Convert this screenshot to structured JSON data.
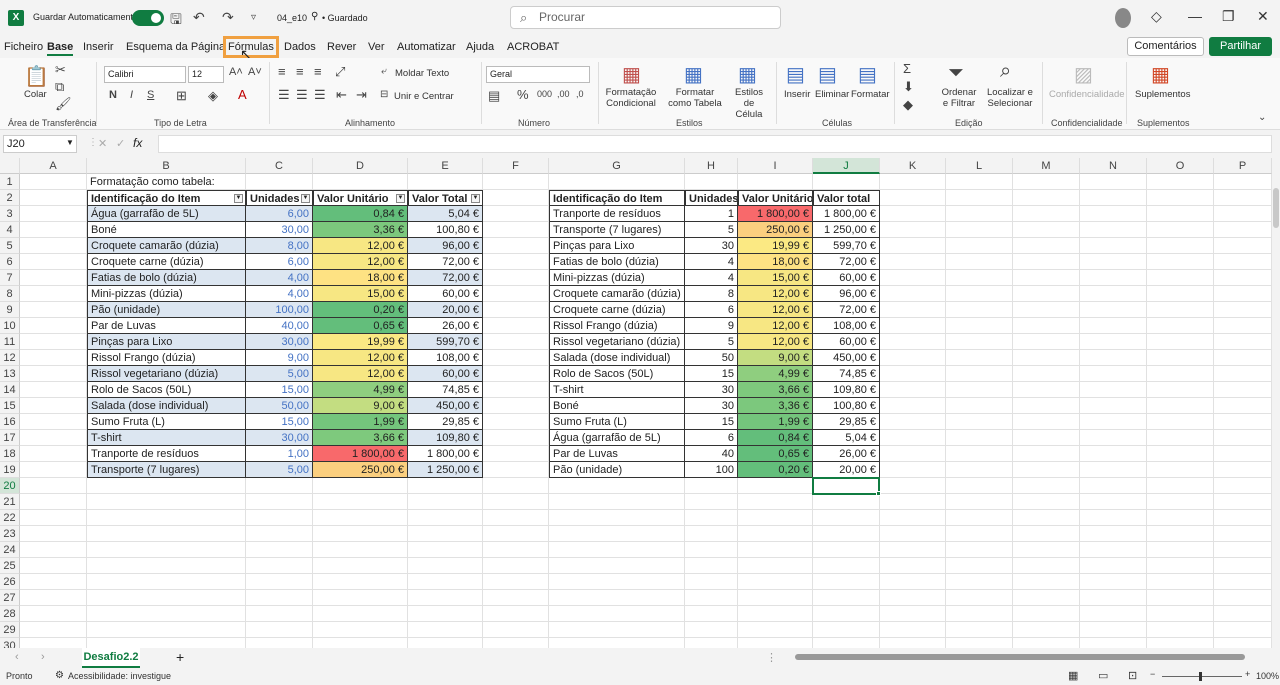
{
  "titlebar": {
    "autosave_label": "Guardar Automaticamente",
    "filename": "04_e10",
    "saved_status": "• Guardado",
    "search_placeholder": "Procurar"
  },
  "menu": {
    "tabs": [
      "Ficheiro",
      "Base",
      "Inserir",
      "Esquema da Página",
      "Fórmulas",
      "Dados",
      "Rever",
      "Ver",
      "Automatizar",
      "Ajuda",
      "ACROBAT"
    ],
    "comments_label": "Comentários",
    "share_label": "Partilhar"
  },
  "ribbon": {
    "paste_label": "Colar",
    "clipboard_group": "Área de Transferência",
    "font_name": "Calibri",
    "font_size": "12",
    "font_group": "Tipo de Letra",
    "wrap_text": "Moldar Texto",
    "merge_center": "Unir e Centrar",
    "alignment_group": "Alinhamento",
    "number_format": "Geral",
    "number_group": "Número",
    "cond_format": "Formatação Condicional",
    "format_table": "Formatar como Tabela",
    "cell_styles": "Estilos de Célula",
    "styles_group": "Estilos",
    "insert": "Inserir",
    "delete": "Eliminar",
    "format": "Formatar",
    "cells_group": "Células",
    "sort_filter": "Ordenar e Filtrar",
    "find_select": "Localizar e Selecionar",
    "editing_group": "Edição",
    "confidentiality": "Confidencialidade",
    "confidentiality_group": "Confidencialidade",
    "addins": "Suplementos",
    "addins_group": "Suplementos"
  },
  "formula_bar": {
    "name_box": "J20",
    "fx": "fx"
  },
  "columns": [
    "A",
    "B",
    "C",
    "D",
    "E",
    "F",
    "G",
    "H",
    "I",
    "J",
    "K",
    "L",
    "M",
    "N",
    "O",
    "P"
  ],
  "rows": [
    "1",
    "2",
    "3",
    "4",
    "5",
    "6",
    "7",
    "8",
    "9",
    "10",
    "11",
    "12",
    "13",
    "14",
    "15",
    "16",
    "17",
    "18",
    "19",
    "20",
    "21",
    "22",
    "23",
    "24",
    "25",
    "26",
    "27",
    "28",
    "29",
    "30"
  ],
  "table1": {
    "caption": "Formatação como tabela:",
    "headers": [
      "Identificação do Item",
      "Unidades",
      "Valor Unitário",
      "Valor Total"
    ],
    "rows": [
      [
        "Água (garrafão de 5L)",
        "6,00",
        "0,84 €",
        "5,04 €"
      ],
      [
        "Boné",
        "30,00",
        "3,36 €",
        "100,80 €"
      ],
      [
        "Croquete camarão (dúzia)",
        "8,00",
        "12,00 €",
        "96,00 €"
      ],
      [
        "Croquete carne (dúzia)",
        "6,00",
        "12,00 €",
        "72,00 €"
      ],
      [
        "Fatias de bolo (dúzia)",
        "4,00",
        "18,00 €",
        "72,00 €"
      ],
      [
        "Mini-pizzas (dúzia)",
        "4,00",
        "15,00 €",
        "60,00 €"
      ],
      [
        "Pão (unidade)",
        "100,00",
        "0,20 €",
        "20,00 €"
      ],
      [
        "Par de Luvas",
        "40,00",
        "0,65 €",
        "26,00 €"
      ],
      [
        "Pinças para Lixo",
        "30,00",
        "19,99 €",
        "599,70 €"
      ],
      [
        "Rissol Frango (dúzia)",
        "9,00",
        "12,00 €",
        "108,00 €"
      ],
      [
        "Rissol vegetariano (dúzia)",
        "5,00",
        "12,00 €",
        "60,00 €"
      ],
      [
        "Rolo de Sacos (50L)",
        "15,00",
        "4,99 €",
        "74,85 €"
      ],
      [
        "Salada (dose individual)",
        "50,00",
        "9,00 €",
        "450,00 €"
      ],
      [
        "Sumo Fruta (L)",
        "15,00",
        "1,99 €",
        "29,85 €"
      ],
      [
        "T-shirt",
        "30,00",
        "3,66 €",
        "109,80 €"
      ],
      [
        "Tranporte de resíduos",
        "1,00",
        "1 800,00 €",
        "1 800,00 €"
      ],
      [
        "Transporte (7 lugares)",
        "5,00",
        "250,00 €",
        "1 250,00 €"
      ]
    ],
    "colors": [
      "#63be7b",
      "#7cc87d",
      "#f7e783",
      "#f7e783",
      "#fee283",
      "#f7e783",
      "#63be7b",
      "#63be7b",
      "#fbe983",
      "#f7e783",
      "#f7e783",
      "#8fce7f",
      "#c3dd81",
      "#74c57c",
      "#7ec97d",
      "#f8696b",
      "#fbcf7f"
    ]
  },
  "table2": {
    "headers": [
      "Identificação do Item",
      "Unidades",
      "Valor Unitário",
      "Valor total"
    ],
    "rows": [
      [
        "Tranporte de resíduos",
        "1",
        "1 800,00 €",
        "1 800,00 €"
      ],
      [
        "Transporte (7 lugares)",
        "5",
        "250,00 €",
        "1 250,00 €"
      ],
      [
        "Pinças para Lixo",
        "30",
        "19,99 €",
        "599,70 €"
      ],
      [
        "Fatias de bolo (dúzia)",
        "4",
        "18,00 €",
        "72,00 €"
      ],
      [
        "Mini-pizzas (dúzia)",
        "4",
        "15,00 €",
        "60,00 €"
      ],
      [
        "Croquete camarão (dúzia)",
        "8",
        "12,00 €",
        "96,00 €"
      ],
      [
        "Croquete carne (dúzia)",
        "6",
        "12,00 €",
        "72,00 €"
      ],
      [
        "Rissol Frango (dúzia)",
        "9",
        "12,00 €",
        "108,00 €"
      ],
      [
        "Rissol vegetariano (dúzia)",
        "5",
        "12,00 €",
        "60,00 €"
      ],
      [
        "Salada (dose individual)",
        "50",
        "9,00 €",
        "450,00 €"
      ],
      [
        "Rolo de Sacos (50L)",
        "15",
        "4,99 €",
        "74,85 €"
      ],
      [
        "T-shirt",
        "30",
        "3,66 €",
        "109,80 €"
      ],
      [
        "Boné",
        "30",
        "3,36 €",
        "100,80 €"
      ],
      [
        "Sumo Fruta (L)",
        "15",
        "1,99 €",
        "29,85 €"
      ],
      [
        "Água (garrafão de 5L)",
        "6",
        "0,84 €",
        "5,04 €"
      ],
      [
        "Par de Luvas",
        "40",
        "0,65 €",
        "26,00 €"
      ],
      [
        "Pão (unidade)",
        "100",
        "0,20 €",
        "20,00 €"
      ]
    ],
    "colors": [
      "#f8696b",
      "#fbcf7f",
      "#fbe983",
      "#fee283",
      "#f7e783",
      "#f7e783",
      "#f7e783",
      "#f7e783",
      "#f7e783",
      "#c3dd81",
      "#8fce7f",
      "#7ec97d",
      "#7cc87d",
      "#74c57c",
      "#63be7b",
      "#63be7b",
      "#63be7b"
    ]
  },
  "sheet_tab": "Desafio2.2",
  "status": {
    "ready": "Pronto",
    "accessibility": "Acessibilidade: investigue",
    "zoom": "100%"
  }
}
